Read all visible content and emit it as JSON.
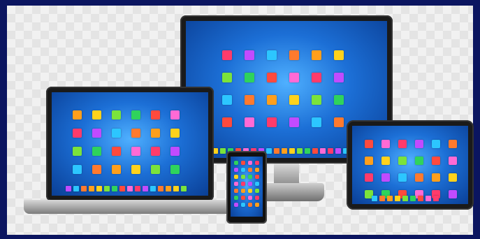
{
  "palette": {
    "background": "#0b1560",
    "tiles": [
      "#ff3b6b",
      "#2fd35c",
      "#ff9f1c",
      "#c14bff",
      "#ff4a3d",
      "#ffd21c",
      "#2cc6ff",
      "#ff6ad5",
      "#7be33b",
      "#ff7a2e"
    ]
  },
  "devices": [
    {
      "name": "monitor",
      "type": "desktop-monitor"
    },
    {
      "name": "laptop",
      "type": "laptop"
    },
    {
      "name": "tablet",
      "type": "tablet"
    },
    {
      "name": "phone",
      "type": "smartphone"
    }
  ]
}
